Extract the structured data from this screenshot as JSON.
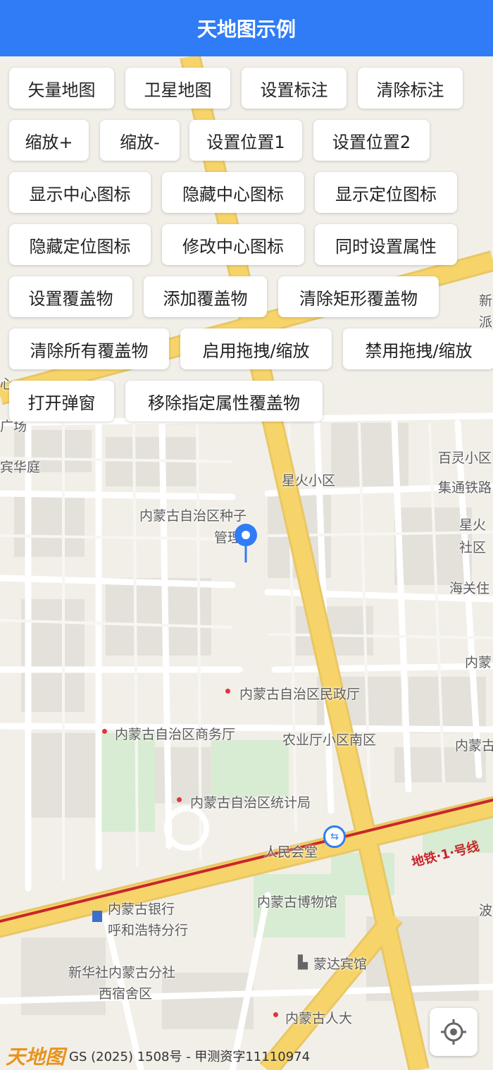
{
  "header": {
    "title": "天地图示例"
  },
  "buttons": [
    {
      "name": "vector-map-button",
      "label": "矢量地图"
    },
    {
      "name": "satellite-map-button",
      "label": "卫星地图"
    },
    {
      "name": "set-label-button",
      "label": "设置标注"
    },
    {
      "name": "clear-label-button",
      "label": "清除标注"
    },
    {
      "name": "zoom-in-button",
      "label": "缩放+"
    },
    {
      "name": "zoom-out-button",
      "label": "缩放-"
    },
    {
      "name": "set-position-1-button",
      "label": "设置位置1"
    },
    {
      "name": "set-position-2-button",
      "label": "设置位置2"
    },
    {
      "name": "show-center-icon-button",
      "label": "显示中心图标"
    },
    {
      "name": "hide-center-icon-button",
      "label": "隐藏中心图标"
    },
    {
      "name": "show-location-icon-button",
      "label": "显示定位图标"
    },
    {
      "name": "hide-location-icon-button",
      "label": "隐藏定位图标"
    },
    {
      "name": "modify-center-icon-button",
      "label": "修改中心图标"
    },
    {
      "name": "set-properties-button",
      "label": "同时设置属性"
    },
    {
      "name": "set-overlay-button",
      "label": "设置覆盖物"
    },
    {
      "name": "add-overlay-button",
      "label": "添加覆盖物"
    },
    {
      "name": "clear-rect-overlay-button",
      "label": "清除矩形覆盖物"
    },
    {
      "name": "clear-all-overlays-button",
      "label": "清除所有覆盖物"
    },
    {
      "name": "enable-drag-zoom-button",
      "label": "启用拖拽/缩放"
    },
    {
      "name": "disable-drag-zoom-button",
      "label": "禁用拖拽/缩放"
    },
    {
      "name": "open-popup-button",
      "label": "打开弹窗"
    },
    {
      "name": "remove-overlay-by-attr-button",
      "label": "移除指定属性覆盖物"
    }
  ],
  "map_labels": [
    "星火小区",
    "内蒙古自治区种子",
    "管理",
    "百灵小区",
    "集通铁路",
    "星火",
    "社区",
    "海关住",
    "内蒙古自治区民政厅",
    "内蒙古自治区商务厅",
    "农业厅小区南区",
    "内蒙古自治区统计局",
    "人民会堂",
    "内蒙古博物馆",
    "内蒙古银行",
    "呼和浩特分行",
    "新华社内蒙古分社",
    "西宿舍区",
    "蒙达宾馆",
    "内蒙古人大",
    "内蒙",
    "内蒙古",
    "新",
    "派",
    "广场",
    "宾华庭",
    "心",
    "波"
  ],
  "metro_label": "地铁·1·号线",
  "footer": {
    "logo_text": "天地图",
    "copyright": "GS (2025) 1508号 - 甲测资字11110974"
  },
  "icons": {
    "marker": "map-pin-icon",
    "locate": "crosshair-icon",
    "metro": "metro-station-icon",
    "hotel": "hotel-icon",
    "bank": "bank-icon"
  },
  "colors": {
    "header": "#2f7cf6",
    "road_major": "#f7d46a",
    "road_minor": "#ffffff",
    "map_bg": "#f2efe9",
    "marker": "#2f7cf6",
    "metro_line": "#c8262c"
  }
}
